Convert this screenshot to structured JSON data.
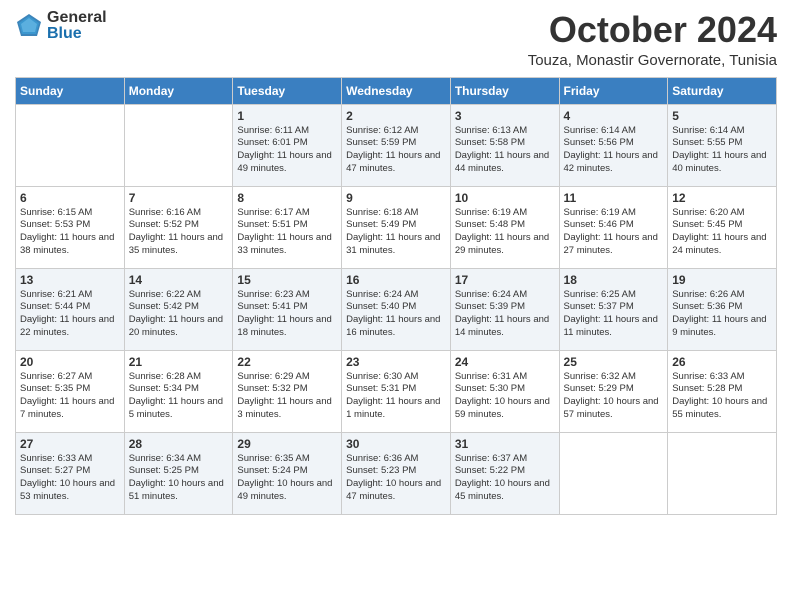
{
  "header": {
    "logo_general": "General",
    "logo_blue": "Blue",
    "month": "October 2024",
    "location": "Touza, Monastir Governorate, Tunisia"
  },
  "days_of_week": [
    "Sunday",
    "Monday",
    "Tuesday",
    "Wednesday",
    "Thursday",
    "Friday",
    "Saturday"
  ],
  "weeks": [
    [
      {
        "day": "",
        "info": ""
      },
      {
        "day": "",
        "info": ""
      },
      {
        "day": "1",
        "sunrise": "6:11 AM",
        "sunset": "6:01 PM",
        "daylight": "11 hours and 49 minutes."
      },
      {
        "day": "2",
        "sunrise": "6:12 AM",
        "sunset": "5:59 PM",
        "daylight": "11 hours and 47 minutes."
      },
      {
        "day": "3",
        "sunrise": "6:13 AM",
        "sunset": "5:58 PM",
        "daylight": "11 hours and 44 minutes."
      },
      {
        "day": "4",
        "sunrise": "6:14 AM",
        "sunset": "5:56 PM",
        "daylight": "11 hours and 42 minutes."
      },
      {
        "day": "5",
        "sunrise": "6:14 AM",
        "sunset": "5:55 PM",
        "daylight": "11 hours and 40 minutes."
      }
    ],
    [
      {
        "day": "6",
        "sunrise": "6:15 AM",
        "sunset": "5:53 PM",
        "daylight": "11 hours and 38 minutes."
      },
      {
        "day": "7",
        "sunrise": "6:16 AM",
        "sunset": "5:52 PM",
        "daylight": "11 hours and 35 minutes."
      },
      {
        "day": "8",
        "sunrise": "6:17 AM",
        "sunset": "5:51 PM",
        "daylight": "11 hours and 33 minutes."
      },
      {
        "day": "9",
        "sunrise": "6:18 AM",
        "sunset": "5:49 PM",
        "daylight": "11 hours and 31 minutes."
      },
      {
        "day": "10",
        "sunrise": "6:19 AM",
        "sunset": "5:48 PM",
        "daylight": "11 hours and 29 minutes."
      },
      {
        "day": "11",
        "sunrise": "6:19 AM",
        "sunset": "5:46 PM",
        "daylight": "11 hours and 27 minutes."
      },
      {
        "day": "12",
        "sunrise": "6:20 AM",
        "sunset": "5:45 PM",
        "daylight": "11 hours and 24 minutes."
      }
    ],
    [
      {
        "day": "13",
        "sunrise": "6:21 AM",
        "sunset": "5:44 PM",
        "daylight": "11 hours and 22 minutes."
      },
      {
        "day": "14",
        "sunrise": "6:22 AM",
        "sunset": "5:42 PM",
        "daylight": "11 hours and 20 minutes."
      },
      {
        "day": "15",
        "sunrise": "6:23 AM",
        "sunset": "5:41 PM",
        "daylight": "11 hours and 18 minutes."
      },
      {
        "day": "16",
        "sunrise": "6:24 AM",
        "sunset": "5:40 PM",
        "daylight": "11 hours and 16 minutes."
      },
      {
        "day": "17",
        "sunrise": "6:24 AM",
        "sunset": "5:39 PM",
        "daylight": "11 hours and 14 minutes."
      },
      {
        "day": "18",
        "sunrise": "6:25 AM",
        "sunset": "5:37 PM",
        "daylight": "11 hours and 11 minutes."
      },
      {
        "day": "19",
        "sunrise": "6:26 AM",
        "sunset": "5:36 PM",
        "daylight": "11 hours and 9 minutes."
      }
    ],
    [
      {
        "day": "20",
        "sunrise": "6:27 AM",
        "sunset": "5:35 PM",
        "daylight": "11 hours and 7 minutes."
      },
      {
        "day": "21",
        "sunrise": "6:28 AM",
        "sunset": "5:34 PM",
        "daylight": "11 hours and 5 minutes."
      },
      {
        "day": "22",
        "sunrise": "6:29 AM",
        "sunset": "5:32 PM",
        "daylight": "11 hours and 3 minutes."
      },
      {
        "day": "23",
        "sunrise": "6:30 AM",
        "sunset": "5:31 PM",
        "daylight": "11 hours and 1 minute."
      },
      {
        "day": "24",
        "sunrise": "6:31 AM",
        "sunset": "5:30 PM",
        "daylight": "10 hours and 59 minutes."
      },
      {
        "day": "25",
        "sunrise": "6:32 AM",
        "sunset": "5:29 PM",
        "daylight": "10 hours and 57 minutes."
      },
      {
        "day": "26",
        "sunrise": "6:33 AM",
        "sunset": "5:28 PM",
        "daylight": "10 hours and 55 minutes."
      }
    ],
    [
      {
        "day": "27",
        "sunrise": "6:33 AM",
        "sunset": "5:27 PM",
        "daylight": "10 hours and 53 minutes."
      },
      {
        "day": "28",
        "sunrise": "6:34 AM",
        "sunset": "5:25 PM",
        "daylight": "10 hours and 51 minutes."
      },
      {
        "day": "29",
        "sunrise": "6:35 AM",
        "sunset": "5:24 PM",
        "daylight": "10 hours and 49 minutes."
      },
      {
        "day": "30",
        "sunrise": "6:36 AM",
        "sunset": "5:23 PM",
        "daylight": "10 hours and 47 minutes."
      },
      {
        "day": "31",
        "sunrise": "6:37 AM",
        "sunset": "5:22 PM",
        "daylight": "10 hours and 45 minutes."
      },
      {
        "day": "",
        "info": ""
      },
      {
        "day": "",
        "info": ""
      }
    ]
  ]
}
